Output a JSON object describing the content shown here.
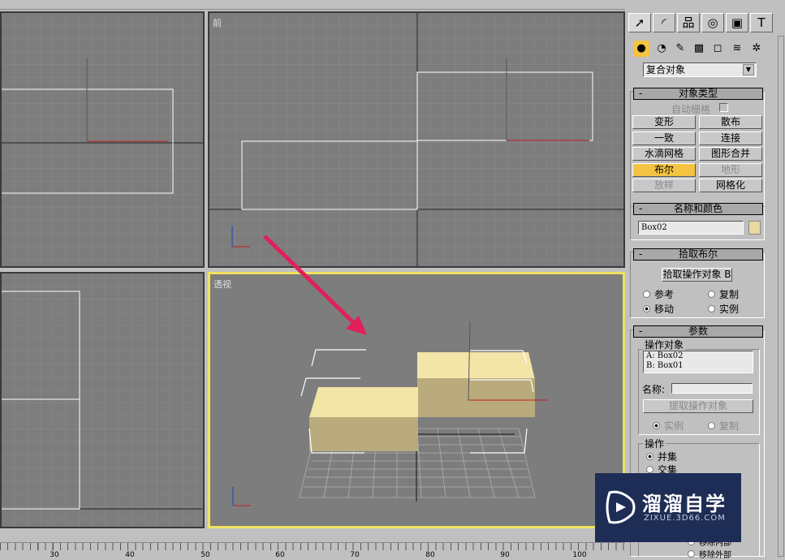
{
  "viewports": {
    "top_left": "",
    "front": "前",
    "bottom_left": "",
    "perspective": "透视"
  },
  "command_panel": {
    "tabs": [
      "create-icon",
      "modify-icon",
      "hierarchy-icon",
      "motion-icon",
      "display-icon",
      "utilities-icon"
    ],
    "subcategories": [
      "geometry-icon",
      "shapes-icon",
      "lights-icon",
      "cameras-icon",
      "helpers-icon",
      "spacewarps-icon",
      "systems-icon"
    ],
    "category_dropdown": "复合对象",
    "object_type": {
      "title": "对象类型",
      "autogrid": "自动栅格",
      "buttons": [
        {
          "label": "变形",
          "state": "normal"
        },
        {
          "label": "散布",
          "state": "normal"
        },
        {
          "label": "一致",
          "state": "normal"
        },
        {
          "label": "连接",
          "state": "normal"
        },
        {
          "label": "水滴网格",
          "state": "normal"
        },
        {
          "label": "图形合并",
          "state": "normal"
        },
        {
          "label": "布尔",
          "state": "active"
        },
        {
          "label": "地形",
          "state": "disabled"
        },
        {
          "label": "放样",
          "state": "disabled"
        },
        {
          "label": "网格化",
          "state": "normal"
        }
      ]
    },
    "name_color": {
      "title": "名称和颜色",
      "name": "Box02",
      "color": "#e8d9a0"
    },
    "pick_boolean": {
      "title": "拾取布尔",
      "pick_button": "拾取操作对象 B",
      "options": [
        "参考",
        "复制",
        "移动",
        "实例"
      ],
      "selected": "移动"
    },
    "parameters": {
      "title": "参数",
      "operands_label": "操作对象",
      "operands": [
        "A:  Box02",
        "B:  Box01"
      ],
      "name_label": "名称:",
      "name_value": "",
      "extract_button": "提取操作对象",
      "extract_options": [
        "实例",
        "复制"
      ],
      "extract_selected": "实例",
      "operation_label": "操作",
      "operations": [
        "并集",
        "交集",
        "移除内部",
        "移除外部"
      ],
      "operation_selected": "并集"
    }
  },
  "ruler": {
    "ticks": [
      "30",
      "40",
      "50",
      "60",
      "70",
      "80",
      "90",
      "100"
    ]
  },
  "watermark": {
    "title": "溜溜自学",
    "url": "ZIXUE.3D66.COM"
  },
  "colors": {
    "viewport_bg": "#7d7d7d",
    "active_border": "#f0e060",
    "box": "#e8d9a0",
    "arrow": "#e0205a"
  }
}
